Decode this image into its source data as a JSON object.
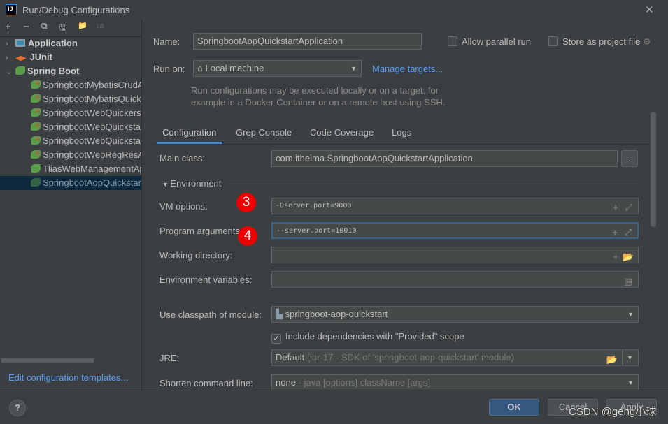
{
  "window": {
    "title": "Run/Debug Configurations",
    "logo": "IJ",
    "close": "✕"
  },
  "toolbar": {
    "add": "+",
    "remove": "−",
    "copy": "⧉",
    "save": "🖫",
    "folder": "📁",
    "sort": "↓a"
  },
  "tree": {
    "groups": [
      {
        "label": "Application",
        "expanded": false
      },
      {
        "label": "JUnit",
        "expanded": false
      },
      {
        "label": "Spring Boot",
        "expanded": true
      }
    ],
    "items": [
      {
        "label": "SpringbootMybatisCrudApplication",
        "error": true
      },
      {
        "label": "SpringbootMybatisQuickstartApplication",
        "error": true
      },
      {
        "label": "SpringbootWebQuickerstartApplication",
        "error": true
      },
      {
        "label": "SpringbootWebQuickstartApplication",
        "error": true
      },
      {
        "label": "SpringbootWebQuickstartApplication",
        "error": true
      },
      {
        "label": "SpringbootWebReqResApplication",
        "error": true
      },
      {
        "label": "TliasWebManagementApplication",
        "error": false
      },
      {
        "label": "SpringbootAopQuickstartApplication",
        "error": false,
        "selected": true
      }
    ]
  },
  "edit_templates": "Edit configuration templates...",
  "form": {
    "name_label": "Name:",
    "name_value": "SpringbootAopQuickstartApplication",
    "allow_parallel": "Allow parallel run",
    "store_project": "Store as project file",
    "run_on_label": "Run on:",
    "run_on_value": "Local machine",
    "manage_targets": "Manage targets...",
    "help_1": "Run configurations may be executed locally or on a target: for",
    "help_2": "example in a Docker Container or on a remote host using SSH.",
    "tabs": [
      "Configuration",
      "Grep Console",
      "Code Coverage",
      "Logs"
    ],
    "main_class_label": "Main class:",
    "main_class_value": "com.itheima.SpringbootAopQuickstartApplication",
    "browse": "...",
    "environment": "Environment",
    "vm_label": "VM options:",
    "vm_value": "-Dserver.port=9000",
    "prog_label": "Program arguments:",
    "prog_value": "--server.port=10010",
    "workdir_label": "Working directory:",
    "workdir_value": "",
    "envvars_label": "Environment variables:",
    "envvars_value": "",
    "classpath_label": "Use classpath of module:",
    "classpath_value": "springboot-aop-quickstart",
    "include_deps": "Include dependencies with \"Provided\" scope",
    "include_checked": true,
    "jre_label": "JRE:",
    "jre_value": "Default",
    "jre_hint": "(jbr-17 - SDK of 'springboot-aop-quickstart' module)",
    "shorten_label": "Shorten command line:",
    "shorten_value": "none",
    "shorten_hint": "- java [options] className [args]"
  },
  "markers": [
    "3",
    "4"
  ],
  "footer": {
    "help": "?",
    "ok": "OK",
    "cancel": "Cancel",
    "apply": "Apply"
  },
  "watermark": "CSDN @geng小球"
}
